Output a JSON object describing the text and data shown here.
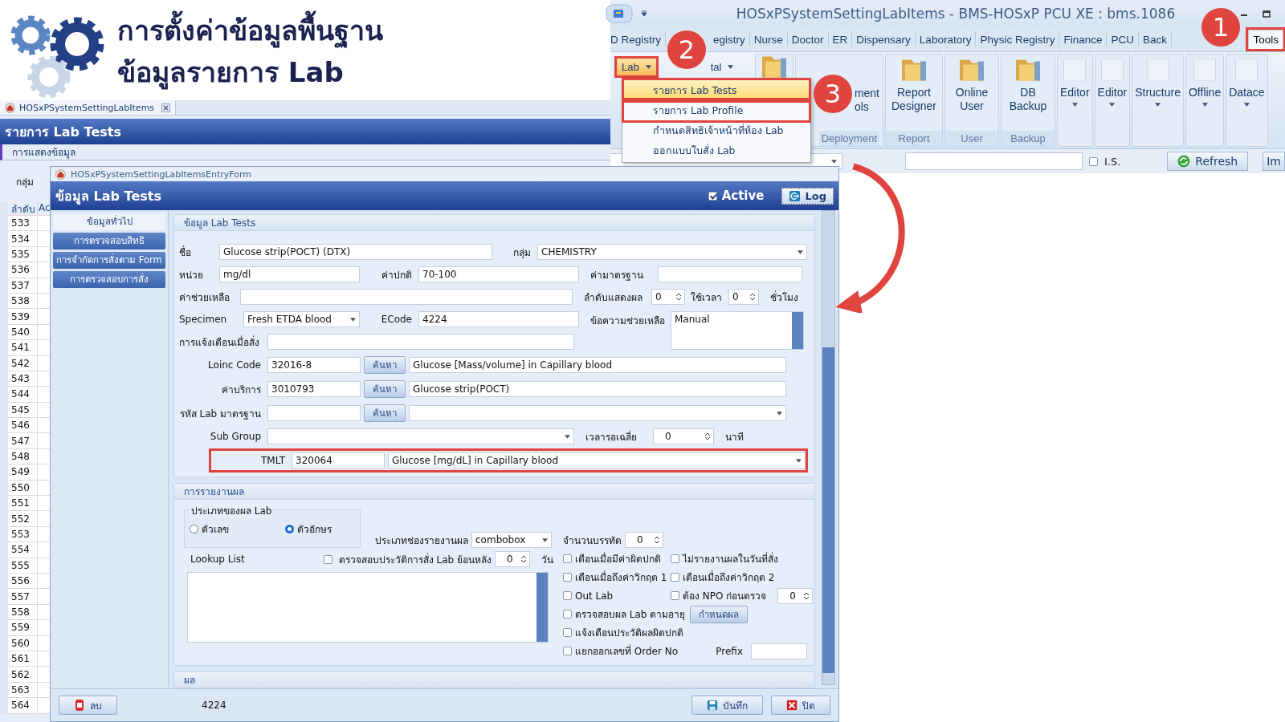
{
  "header": {
    "title_line_1": "การตั้งค่าข้อมูลพื้นฐาน",
    "title_line_2": "ข้อมูลรายการ Lab"
  },
  "ribbon_window": {
    "title": "HOSxPSystemSettingLabItems - BMS-HOSxP PCU XE : bms.1086",
    "tabs": [
      {
        "label": "D Registry",
        "selected": false,
        "annotated": false
      },
      {
        "label": "egistry",
        "selected": false,
        "annotated": false
      },
      {
        "label": "Nurse",
        "selected": false,
        "annotated": false
      },
      {
        "label": "Doctor",
        "selected": false,
        "annotated": false
      },
      {
        "label": "ER",
        "selected": false,
        "annotated": false
      },
      {
        "label": "Dispensary",
        "selected": false,
        "annotated": false
      },
      {
        "label": "Laboratory",
        "selected": false,
        "annotated": false
      },
      {
        "label": "Physic Registry",
        "selected": false,
        "annotated": false
      },
      {
        "label": "Finance",
        "selected": false,
        "annotated": false
      },
      {
        "label": "PCU",
        "selected": false,
        "annotated": false
      },
      {
        "label": "Back",
        "selected": false,
        "annotated": false
      },
      {
        "label": "Tools",
        "selected": true,
        "annotated": true
      }
    ],
    "small_buttons": [
      {
        "label": "Lab",
        "highlighted": true,
        "annotated": true
      },
      {
        "label": "tal",
        "highlighted": false,
        "annotated": false
      }
    ],
    "large_buttons": [
      {
        "kind": "folder"
      },
      {
        "kind": "text",
        "lines": [
          "ment",
          "ols"
        ],
        "group": "Deployment"
      },
      {
        "kind": "folder",
        "lines": [
          "Report",
          "Designer"
        ],
        "group": "Report"
      },
      {
        "kind": "folder",
        "lines": [
          "Online",
          "User"
        ],
        "group": "User"
      },
      {
        "kind": "folder",
        "lines": [
          "DB",
          "Backup"
        ],
        "group": "Backup"
      },
      {
        "kind": "blank",
        "lines": [
          "Editor"
        ]
      },
      {
        "kind": "blank",
        "lines": [
          "Editor"
        ]
      },
      {
        "kind": "blank",
        "lines": [
          "Structure"
        ]
      },
      {
        "kind": "blank",
        "lines": [
          "Offline"
        ]
      },
      {
        "kind": "blank",
        "lines": [
          "Datace"
        ]
      }
    ],
    "menu": [
      {
        "label": "รายการ Lab Tests",
        "selected": true,
        "annotated": true
      },
      {
        "label": "รายการ Lab Profile",
        "selected": false,
        "annotated": true
      },
      {
        "label": "กำหนดสิทธิเจ้าหน้าที่ห้อง Lab",
        "selected": false,
        "annotated": false
      },
      {
        "label": "ออกแบบใบสั่ง Lab",
        "selected": false,
        "annotated": false
      }
    ],
    "search_row": {
      "is": {
        "label": "I.S.",
        "checked": false
      },
      "refresh": "Refresh",
      "cut_button": "Im"
    }
  },
  "list_window": {
    "tab": "HOSxPSystemSettingLabItems",
    "title": "รายการ Lab Tests",
    "section": "การแสดงข้อมูล",
    "group_label": "กลุ่ม",
    "columns": [
      "ลำดับ",
      "Ac"
    ],
    "rows": [
      "533",
      "534",
      "535",
      "536",
      "537",
      "538",
      "539",
      "540",
      "541",
      "542",
      "543",
      "544",
      "545",
      "546",
      "547",
      "548",
      "549",
      "550",
      "551",
      "552",
      "553",
      "554",
      "555",
      "556",
      "557",
      "558",
      "559",
      "560",
      "561",
      "562",
      "563",
      "564"
    ]
  },
  "form": {
    "subtitle": "HOSxPSystemSettingLabItemsEntryForm",
    "title": "ข้อมูล Lab Tests",
    "active": {
      "label": "Active",
      "checked": true
    },
    "log_button": "Log",
    "nav": [
      {
        "label": "ข้อมูลทั่วไป",
        "selected": true
      },
      {
        "label": "การตรวจสอบสิทธิ",
        "selected": false
      },
      {
        "label": "การจำกัดการสั่งตาม Form",
        "selected": false
      },
      {
        "label": "การตรวจสอบการสั่ง",
        "selected": false
      }
    ],
    "general": {
      "title": "ข้อมูล Lab Tests",
      "name_label": "ชื่อ",
      "name": "Glucose strip(POCT) (DTX)",
      "group_label": "กลุ่ม",
      "group": "CHEMISTRY",
      "unit_label": "หน่วย",
      "unit": "mg/dl",
      "normal_label": "ค่าปกติ",
      "normal": "70-100",
      "standard_label": "ค่ามาตรฐาน",
      "help_label": "ค่าช่วยเหลือ",
      "order_label": "ลำดับแสดงผล",
      "order": "0",
      "time_label": "ใช้เวลา",
      "time": "0",
      "hours_label": "ชั่วโมง",
      "specimen_label": "Specimen",
      "specimen": "Fresh ETDA blood",
      "ecode_label": "ECode",
      "ecode": "4224",
      "help_text_label": "ข้อความช่วยเหลือ",
      "help_text": "Manual",
      "alert_label": "การแจ้งเตือนเมื่อสั่ง",
      "lookups": [
        {
          "kind": "text",
          "label": "Loinc Code",
          "code": "32016-8",
          "button": "ค้นหา",
          "description": "Glucose [Mass/volume] in Capillary blood"
        },
        {
          "kind": "text",
          "label": "ค่าบริการ",
          "code": "3010793",
          "button": "ค้นหา",
          "description": "Glucose strip(POCT)"
        },
        {
          "kind": "combo",
          "label": "รหัส Lab มาตรฐาน",
          "button": "ค้นหา"
        }
      ],
      "subgroup_label": "Sub Group",
      "wait_label": "เวลารอเฉลี่ย",
      "wait": "0",
      "minutes_label": "นาที",
      "tmlt": {
        "label": "TMLT",
        "code": "320064",
        "description": "Glucose [mg/dL] in Capillary blood",
        "annotated": true
      }
    },
    "reporting": {
      "title": "การรายงานผล",
      "result_type": {
        "title": "ประเภทของผล Lab",
        "options": [
          {
            "label": "ตัวเลข",
            "selected": false
          },
          {
            "label": "ตัวอักษร",
            "selected": true
          }
        ]
      },
      "field_type_label": "ประเภทช่องรายงานผล",
      "field_type": "combobox",
      "lines_label": "จำนวนบรรทัด",
      "lines": "0",
      "lookup_label": "Lookup List",
      "history": {
        "label": "ตรวจสอบประวัติการสั่ง Lab ย้อนหลัง",
        "checked": false,
        "days": "0",
        "unit": "วัน"
      },
      "checks": [
        {
          "label": "เตือนเมื่อมีค่าผิดปกติ",
          "checked": false
        },
        {
          "label": "ไม่รายงานผลในวันที่สั่ง",
          "checked": false
        },
        {
          "label": "เตือนเมื่อถึงค่าวิกฤต 1",
          "checked": false
        },
        {
          "label": "เตือนเมื่อถึงค่าวิกฤต 2",
          "checked": false
        },
        {
          "label": "Out Lab",
          "checked": false
        },
        {
          "label": "ต้อง NPO ก่อนตรวจ",
          "checked": false
        },
        {
          "label": "ตรวจสอบผล Lab ตามอายุ",
          "checked": false
        },
        {
          "label": "แจ้งเตือนประวัติผลผิดปกติ",
          "checked": false
        },
        {
          "label": "แยกออกเลขที่ Order No",
          "checked": false
        }
      ],
      "npo_value": "0",
      "age_button": "กำหนดผล",
      "prefix_label": "Prefix"
    },
    "result_title": "ผล",
    "footer": {
      "delete": "ลบ",
      "code": "4224",
      "save": "บันทึก",
      "close": "ปิด"
    }
  },
  "badges": [
    "1",
    "2",
    "3"
  ]
}
